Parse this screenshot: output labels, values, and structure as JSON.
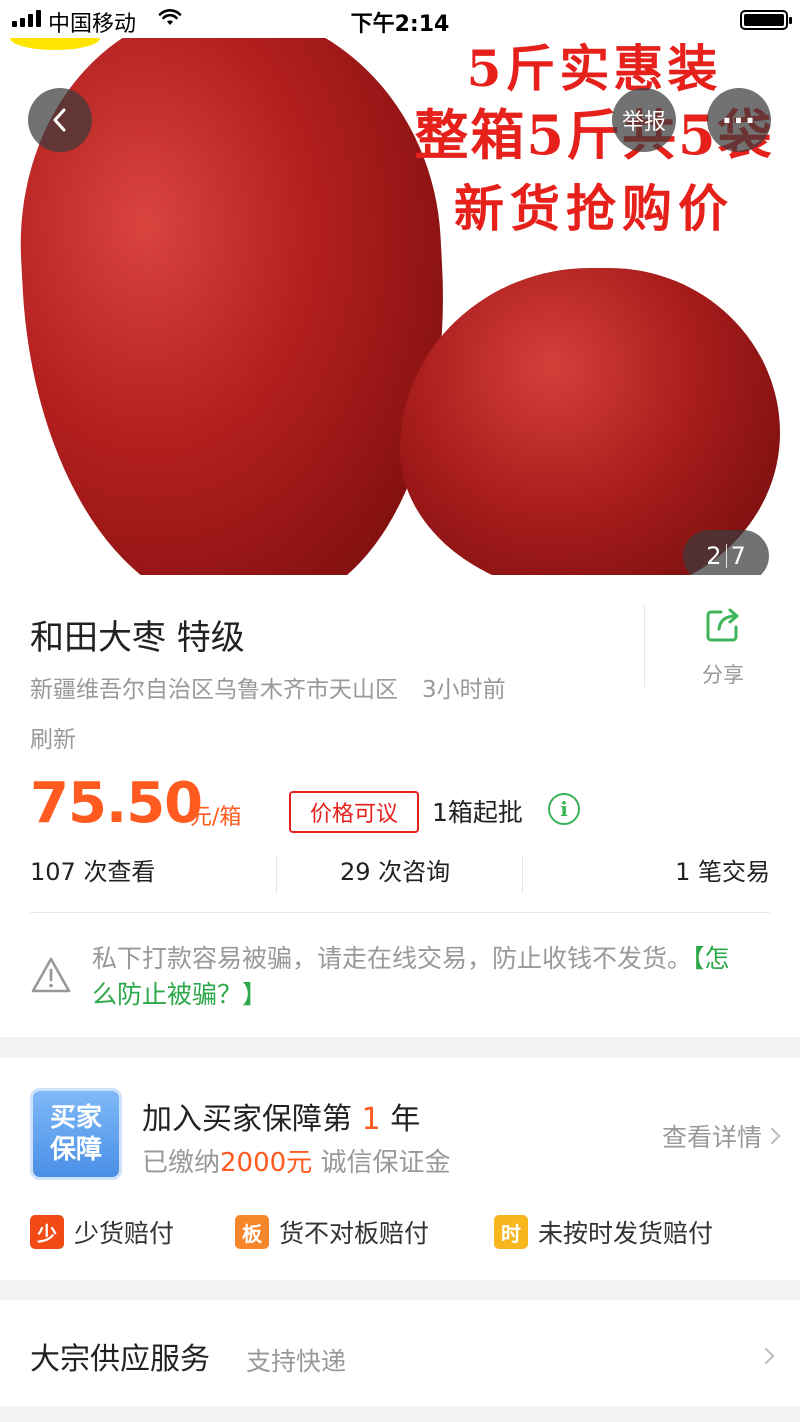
{
  "status_bar": {
    "carrier": "中国移动",
    "time": "下午2:14"
  },
  "hero": {
    "promo_lines": [
      "5斤实惠装",
      "整箱5斤共5袋",
      "新货抢购价"
    ],
    "report_label": "举报",
    "more_label": "···",
    "counter_current": "2",
    "counter_total": "7"
  },
  "product": {
    "title": "和田大枣 特级",
    "location": "新疆维吾尔自治区乌鲁木齐市天山区",
    "time_ago": "3小时前",
    "refresh": "刷新",
    "share_label": "分享",
    "price": "75.50",
    "unit": "元/箱",
    "negotiable": "价格可议",
    "moq": "1箱起批",
    "info_icon": "i"
  },
  "stats": {
    "views": "107 次查看",
    "inquiries": "29 次咨询",
    "trades": "1 笔交易"
  },
  "warning": {
    "text": "私下打款容易被骗，请走在线交易，防止收钱不发货。",
    "link": "【怎么防止被骗？】"
  },
  "guarantee": {
    "badge_line1": "买家",
    "badge_line2": "保障",
    "title_prefix": "加入买家保障第",
    "year": "1",
    "title_suffix": "年",
    "sub_prefix": "已缴纳",
    "amount": "2000元",
    "sub_suffix": "诚信保证金",
    "more": "查看详情",
    "perks": [
      {
        "icon": "少",
        "label": "少货赔付"
      },
      {
        "icon": "板",
        "label": "货不对板赔付"
      },
      {
        "icon": "时",
        "label": "未按时发货赔付"
      }
    ]
  },
  "supply": {
    "title": "大宗供应服务",
    "sub": "支持快递"
  },
  "colors": {
    "price": "#ff5a1f",
    "negotiable": "#e6211b",
    "link": "#2da84a",
    "badge": "#4a8fe6"
  }
}
